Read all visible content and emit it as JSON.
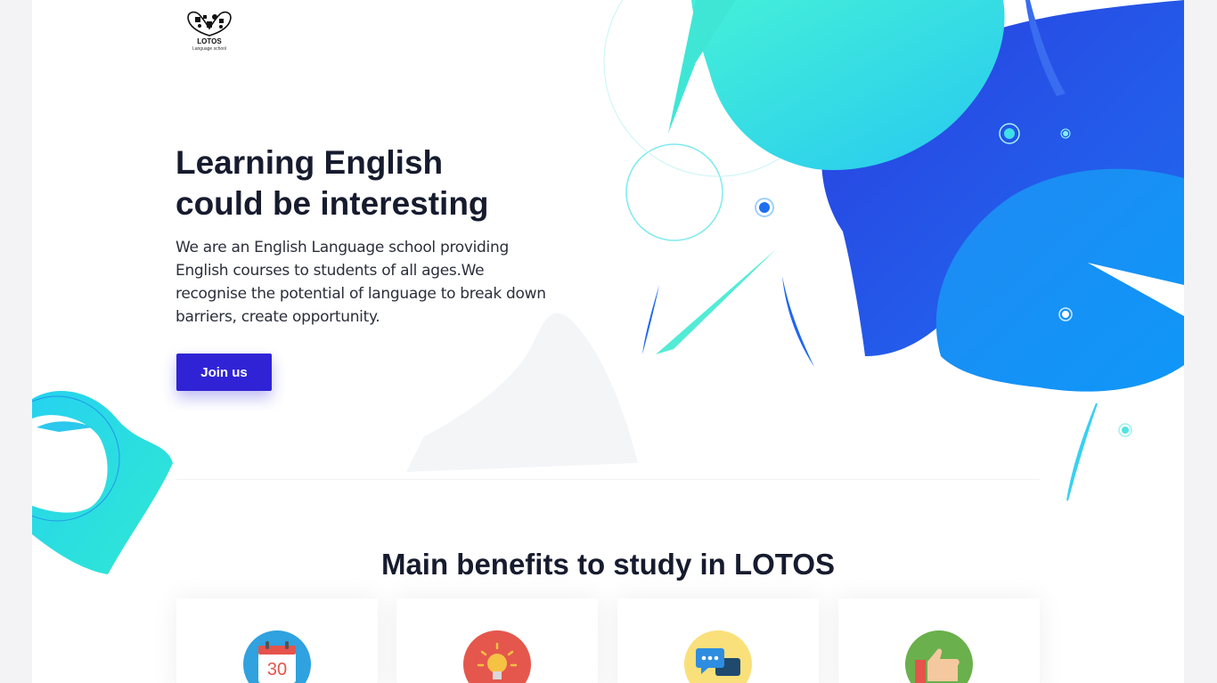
{
  "logo": {
    "name": "LOTOS",
    "subtitle": "Language school"
  },
  "hero": {
    "title_line1": "Learning English",
    "title_line2": "could be interesting",
    "description": "We are an English Language school providing English courses to students of all ages.We recognise the potential of language to break down barriers, create opportunity.",
    "cta_label": "Join us"
  },
  "benefits": {
    "title": "Main benefits to study in LOTOS",
    "cards": [
      {
        "icon": "calendar-icon",
        "icon_text": "30"
      },
      {
        "icon": "lightbulb-icon"
      },
      {
        "icon": "chat-icon"
      },
      {
        "icon": "thumbs-up-icon"
      }
    ]
  },
  "colors": {
    "accent": "#3023d6",
    "heading": "#161b2e",
    "blob_cyan": "#2ee6d6",
    "blob_blue": "#1f4fe0"
  }
}
